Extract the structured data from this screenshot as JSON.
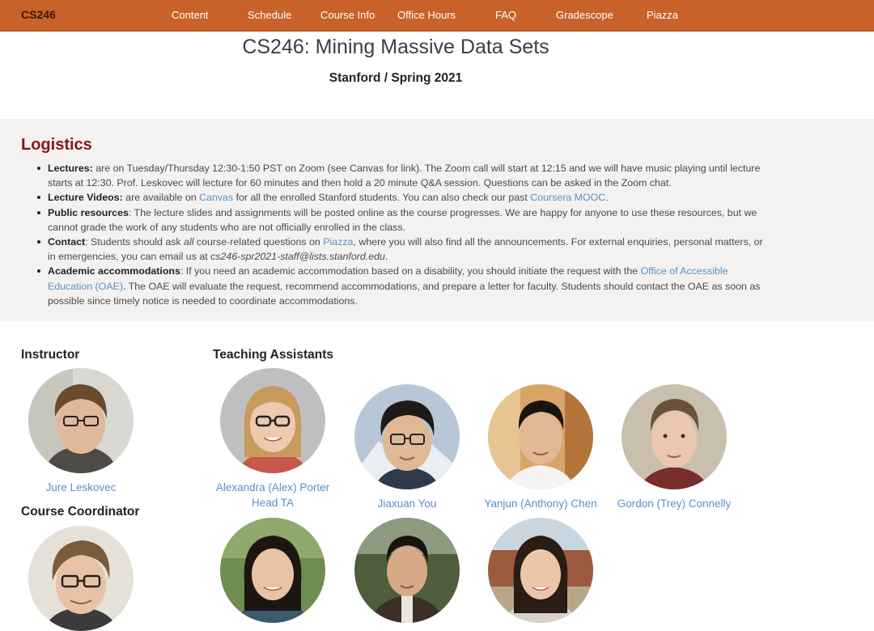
{
  "nav": {
    "brand": "CS246",
    "links": [
      "Content",
      "Schedule",
      "Course Info",
      "Office Hours",
      "FAQ",
      "Gradescope",
      "Piazza"
    ]
  },
  "header": {
    "title": "CS246: Mining Massive Data Sets",
    "subtitle": "Stanford / Spring 2021"
  },
  "logistics": {
    "heading": "Logistics",
    "lectures": {
      "label": "Lectures:",
      "text": " are on Tuesday/Thursday 12:30-1:50 PST on Zoom (see Canvas for link). The Zoom call will start at 12:15 and we will have music playing until lecture starts at 12:30. Prof. Leskovec will lecture for 60 minutes and then hold a 20 minute Q&A session. Questions can be asked in the Zoom chat."
    },
    "videos": {
      "label": "Lecture Videos:",
      "text1": " are available on ",
      "link1": "Canvas",
      "text2": " for all the enrolled Stanford students. You can also check our past ",
      "link2": "Coursera MOOC",
      "text3": "."
    },
    "resources": {
      "label": "Public resources",
      "text": ": The lecture slides and assignments will be posted online as the course progresses. We are happy for anyone to use these resources, but we cannot grade the work of any students who are not officially enrolled in the class."
    },
    "contact": {
      "label": "Contact",
      "text1": ": Students should ask ",
      "em": "all",
      "text2": " course-related questions on ",
      "link": "Piazza",
      "text3": ", where you will also find all the announcements. For external enquiries, personal matters, or in emergencies, you can email us at ",
      "email": "cs246-spr2021-staff@lists.stanford.edu",
      "text4": "."
    },
    "accommodations": {
      "label": "Academic accommodations",
      "text1": ": If you need an academic accommodation based on a disability, you should initiate the request with the ",
      "link": "Office of Accessible Education (OAE)",
      "text2": ". The OAE will evaluate the request, recommend accommodations, and prepare a letter for faculty. Students should contact the OAE as soon as possible since timely notice is needed to coordinate accommodations."
    }
  },
  "staff": {
    "instructor_heading": "Instructor",
    "coordinator_heading": "Course Coordinator",
    "ta_heading": "Teaching Assistants",
    "instructor": {
      "name": "Jure Leskovec"
    },
    "tas": [
      {
        "name": "Alexandra (Alex) Porter",
        "role": "Head TA"
      },
      {
        "name": "Jiaxuan You"
      },
      {
        "name": "Yanjun (Anthony) Chen"
      },
      {
        "name": "Gordon (Trey) Connelly"
      }
    ]
  },
  "colors": {
    "nav_bg": "#c8612a",
    "heading_red": "#8c1515",
    "link_blue": "#5b8fc7",
    "logistics_bg": "#f3f2f0"
  }
}
